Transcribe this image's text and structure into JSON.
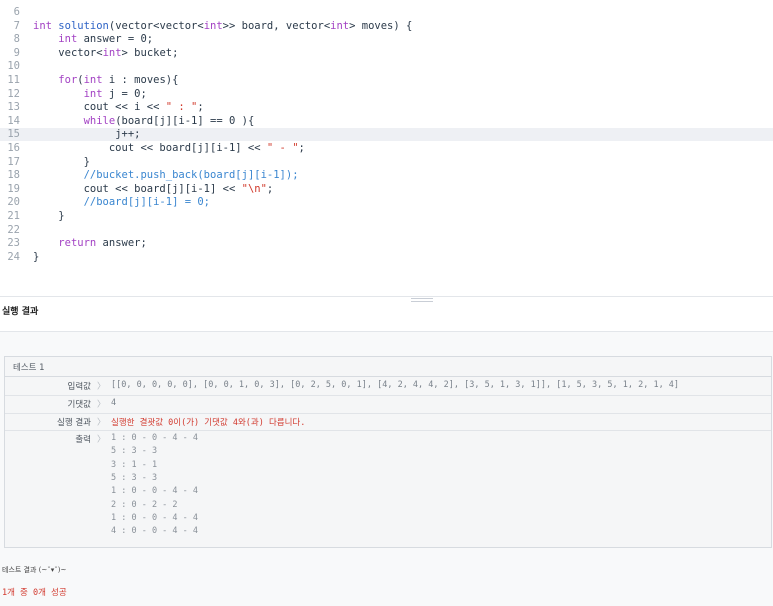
{
  "editor": {
    "lines": [
      {
        "num": "6",
        "indent": "",
        "tokens": []
      },
      {
        "num": "7",
        "indent": "",
        "tokens": [
          {
            "t": "ty",
            "v": "int"
          },
          {
            "t": "",
            "v": " "
          },
          {
            "t": "fn",
            "v": "solution"
          },
          {
            "t": "",
            "v": "(vector<vector<"
          },
          {
            "t": "ty",
            "v": "int"
          },
          {
            "t": "",
            "v": ">> board, vector<"
          },
          {
            "t": "ty",
            "v": "int"
          },
          {
            "t": "",
            "v": "> moves) {"
          }
        ]
      },
      {
        "num": "8",
        "indent": "    ",
        "tokens": [
          {
            "t": "ty",
            "v": "int"
          },
          {
            "t": "",
            "v": " answer = 0;"
          }
        ]
      },
      {
        "num": "9",
        "indent": "    ",
        "tokens": [
          {
            "t": "",
            "v": "vector<"
          },
          {
            "t": "ty",
            "v": "int"
          },
          {
            "t": "",
            "v": "> bucket;"
          }
        ]
      },
      {
        "num": "10",
        "indent": "",
        "tokens": []
      },
      {
        "num": "11",
        "indent": "    ",
        "tokens": [
          {
            "t": "kw",
            "v": "for"
          },
          {
            "t": "",
            "v": "("
          },
          {
            "t": "ty",
            "v": "int"
          },
          {
            "t": "",
            "v": " i : moves){"
          }
        ]
      },
      {
        "num": "12",
        "indent": "        ",
        "tokens": [
          {
            "t": "ty",
            "v": "int"
          },
          {
            "t": "",
            "v": " j = 0;"
          }
        ]
      },
      {
        "num": "13",
        "indent": "        ",
        "tokens": [
          {
            "t": "",
            "v": "cout << i << "
          },
          {
            "t": "str",
            "v": "\" : \""
          },
          {
            "t": "",
            "v": ";"
          }
        ]
      },
      {
        "num": "14",
        "indent": "        ",
        "tokens": [
          {
            "t": "kw",
            "v": "while"
          },
          {
            "t": "",
            "v": "(board[j][i-1] == 0 ){"
          }
        ]
      },
      {
        "num": "15",
        "indent": "             ",
        "tokens": [
          {
            "t": "",
            "v": "j++;"
          }
        ],
        "active": true
      },
      {
        "num": "16",
        "indent": "            ",
        "tokens": [
          {
            "t": "",
            "v": "cout << board[j][i-1] << "
          },
          {
            "t": "str",
            "v": "\" - \""
          },
          {
            "t": "",
            "v": ";"
          }
        ]
      },
      {
        "num": "17",
        "indent": "        ",
        "tokens": [
          {
            "t": "",
            "v": "}"
          }
        ]
      },
      {
        "num": "18",
        "indent": "        ",
        "tokens": [
          {
            "t": "cm",
            "v": "//bucket.push_back(board[j][i-1]);"
          }
        ]
      },
      {
        "num": "19",
        "indent": "        ",
        "tokens": [
          {
            "t": "",
            "v": "cout << board[j][i-1] << "
          },
          {
            "t": "str",
            "v": "\"\\n\""
          },
          {
            "t": "",
            "v": ";"
          }
        ]
      },
      {
        "num": "20",
        "indent": "        ",
        "tokens": [
          {
            "t": "cm",
            "v": "//board[j][i-1] = 0;"
          }
        ]
      },
      {
        "num": "21",
        "indent": "    ",
        "tokens": [
          {
            "t": "",
            "v": "}"
          }
        ]
      },
      {
        "num": "22",
        "indent": "",
        "tokens": []
      },
      {
        "num": "23",
        "indent": "    ",
        "tokens": [
          {
            "t": "kw",
            "v": "return"
          },
          {
            "t": "",
            "v": " answer;"
          }
        ]
      },
      {
        "num": "24",
        "indent": "",
        "tokens": [
          {
            "t": "",
            "v": "}"
          }
        ]
      }
    ]
  },
  "results": {
    "title": "실행 결과",
    "test": {
      "name": "테스트 1",
      "input_label": "입력값",
      "input_value": "[[0, 0, 0, 0, 0], [0, 0, 1, 0, 3], [0, 2, 5, 0, 1], [4, 2, 4, 4, 2], [3, 5, 1, 3, 1]], [1, 5, 3, 5, 1, 2, 1, 4]",
      "expected_label": "기댓값",
      "expected_value": "4",
      "result_label": "실행 결과",
      "result_value": "실행한 결괏값 0이(가) 기댓값 4와(과) 다릅니다.",
      "output_label": "출력",
      "output_lines": [
        "1 : 0 - 0 - 4 - 4",
        "5 : 3 - 3",
        "3 : 1 - 1",
        "5 : 3 - 3",
        "1 : 0 - 0 - 4 - 4",
        "2 : 0 - 2 - 2",
        "1 : 0 - 0 - 4 - 4",
        "4 : 0 - 0 - 4 - 4"
      ]
    },
    "summary_label": "테스트 결과 (~˘▾˘)~",
    "summary_value": "1개 중 0개 성공"
  },
  "colors": {
    "error": "#d23a2f",
    "keyword": "#a342c4",
    "function": "#2e63c6",
    "comment": "#3a86d0",
    "active_line": "#eef0f4"
  }
}
